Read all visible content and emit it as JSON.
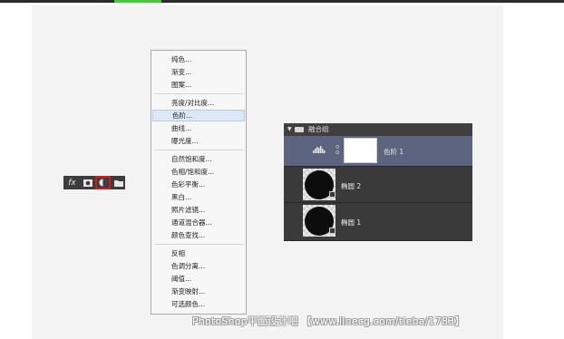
{
  "layer_toolbar": {
    "fx_label": "fx",
    "icons": [
      "fx-icon",
      "mask-icon",
      "adjustment-layer-icon",
      "folder-icon"
    ],
    "highlight_color": "#d61a1a"
  },
  "adjustment_menu": {
    "items": [
      "纯色...",
      "渐变...",
      "图案...",
      "亮度/对比度...",
      "色阶...",
      "曲线...",
      "曝光度...",
      "自然饱和度...",
      "色相/饱和度...",
      "色彩平衡...",
      "黑白...",
      "照片滤镜...",
      "通道混合器...",
      "颜色查找...",
      "反相",
      "色调分离...",
      "阈值...",
      "渐变映射...",
      "可选颜色..."
    ],
    "selected": "色阶..."
  },
  "layers_panel": {
    "group_name": "融合组",
    "adjustment_layer_name": "色阶 1",
    "layers": [
      "椭圆 2",
      "椭圆 1"
    ],
    "selected_color": "#5d6480"
  },
  "watermark": "PhotoShop平面设计吧 【www.linecg.com/tieba/1783】"
}
